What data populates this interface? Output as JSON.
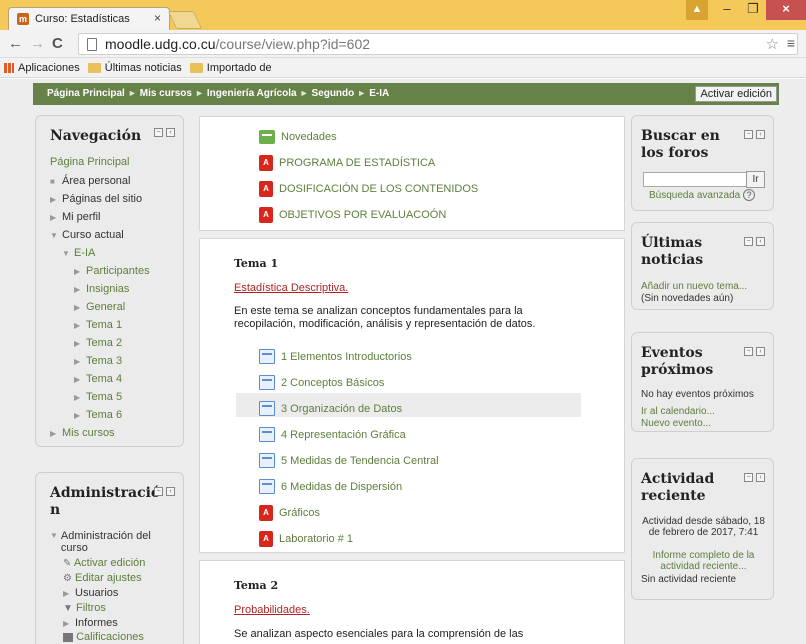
{
  "browser": {
    "tab_title": "Curso: Estadísticas",
    "tab_close": "×",
    "url_host": "moodle.udg.co.cu",
    "url_path": "/course/view.php?id=602",
    "bookmarks": [
      "Aplicaciones",
      "Últimas noticias",
      "Importado desde Firefox"
    ],
    "window_buttons": {
      "min": "–",
      "max": "❐",
      "close": "×"
    }
  },
  "breadcrumb": [
    "Página Principal",
    "Mis cursos",
    "Ingeniería Agrícola",
    "Segundo",
    "E-IA"
  ],
  "breadcrumb_sep": "►",
  "edit_button": "Activar edición",
  "navigation": {
    "title": "Navegación",
    "home": "Página Principal",
    "items": [
      {
        "label": "Área personal",
        "marker": "■",
        "indent": 0
      },
      {
        "label": "Páginas del sitio",
        "marker": "▶",
        "indent": 0
      },
      {
        "label": "Mi perfil",
        "marker": "▶",
        "indent": 0
      },
      {
        "label": "Curso actual",
        "marker": "▼",
        "indent": 0
      },
      {
        "label": "E-IA",
        "marker": "▼",
        "indent": 1
      },
      {
        "label": "Participantes",
        "marker": "▶",
        "indent": 2
      },
      {
        "label": "Insignias",
        "marker": "▶",
        "indent": 2
      },
      {
        "label": "General",
        "marker": "▶",
        "indent": 2
      },
      {
        "label": "Tema 1",
        "marker": "▶",
        "indent": 2
      },
      {
        "label": "Tema 2",
        "marker": "▶",
        "indent": 2
      },
      {
        "label": "Tema 3",
        "marker": "▶",
        "indent": 2
      },
      {
        "label": "Tema 4",
        "marker": "▶",
        "indent": 2
      },
      {
        "label": "Tema 5",
        "marker": "▶",
        "indent": 2
      },
      {
        "label": "Tema 6",
        "marker": "▶",
        "indent": 2
      },
      {
        "label": "Mis cursos",
        "marker": "▶",
        "indent": 0
      }
    ]
  },
  "administration": {
    "title_line1": "Administració",
    "title_line2": "n",
    "section": "Administración del curso",
    "items": [
      "Activar edición",
      "Editar ajustes",
      "Usuarios",
      "Filtros",
      "Informes",
      "Calificaciones"
    ]
  },
  "general_section": {
    "resources": [
      {
        "type": "forum",
        "label": "Novedades"
      },
      {
        "type": "pdf",
        "label": "PROGRAMA DE ESTADÍSTICA"
      },
      {
        "type": "pdf",
        "label": "DOSIFICACIÓN DE LOS CONTENIDOS"
      },
      {
        "type": "pdf",
        "label": "OBJETIVOS POR EVALUACOÓN"
      }
    ]
  },
  "tema1": {
    "title": "Tema 1",
    "subtitle": "Estadística Descriptiva.",
    "summary": "En este tema se analizan conceptos fundamentales para la recopilación, modificación, análisis y representación de datos.",
    "resources": [
      {
        "type": "page",
        "label": "1 Elementos Introductorios"
      },
      {
        "type": "page",
        "label": "2 Conceptos Básicos"
      },
      {
        "type": "page",
        "label": "3 Organización de Datos"
      },
      {
        "type": "page",
        "label": "4 Representación Gráfica"
      },
      {
        "type": "page",
        "label": "5 Medidas de Tendencia Central"
      },
      {
        "type": "page",
        "label": "6 Medidas de Dispersión"
      },
      {
        "type": "pdf",
        "label": "Gráficos"
      },
      {
        "type": "pdf",
        "label": "Laboratorio # 1"
      }
    ]
  },
  "tema2": {
    "title": "Tema 2",
    "subtitle": "Probabilidades.",
    "summary": "Se analizan aspecto esenciales para la comprensión de las"
  },
  "search_forums": {
    "title": "Buscar en los foros",
    "button": "Ir",
    "advanced": "Búsqueda avanzada",
    "help_icon": "?"
  },
  "latest_news": {
    "title": "Últimas noticias",
    "add_link": "Añadir un nuevo tema...",
    "empty": "(Sin novedades aún)"
  },
  "upcoming_events": {
    "title": "Eventos próximos",
    "empty": "No hay eventos próximos",
    "calendar_link": "Ir al calendario...",
    "new_event": "Nuevo evento..."
  },
  "recent_activity": {
    "title": "Actividad reciente",
    "since": "Actividad desde sábado, 18 de febrero de 2017, 7:41",
    "full_report": "Informe completo de la actividad reciente...",
    "none": "Sin actividad reciente"
  },
  "colors": {
    "accent": "#5d7e3c",
    "header": "#668249",
    "tab_bar": "#f5c85a"
  }
}
